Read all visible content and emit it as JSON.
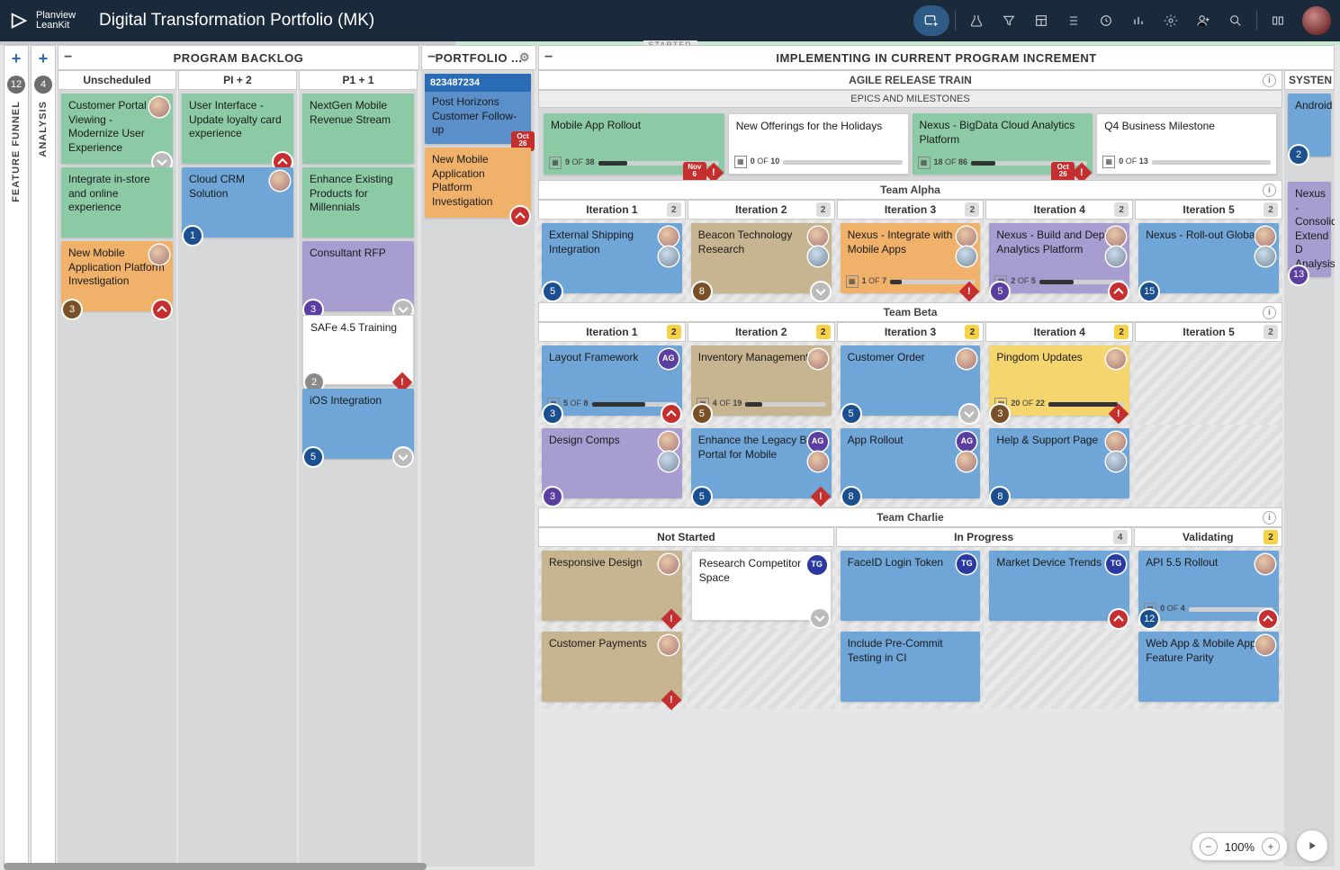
{
  "app": {
    "brand_top": "Planview",
    "brand_bottom": "LeanKit",
    "title": "Digital Transformation Portfolio (MK)"
  },
  "progress_label": "STARTED",
  "rails": [
    {
      "count": "12",
      "label": "FEATURE FUNNEL"
    },
    {
      "count": "4",
      "label": "ANALYSIS"
    }
  ],
  "backlog": {
    "header": "PROGRAM BACKLOG",
    "cols": [
      {
        "title": "Unscheduled",
        "cards": [
          {
            "t": "Customer Portal Viewing - Modernize User Experience",
            "c": "green",
            "av": true,
            "br": "chev"
          },
          {
            "t": "Integrate in-store and online experience",
            "c": "green"
          },
          {
            "t": "New Mobile Application Platform Investigation",
            "c": "orange",
            "av": true,
            "bl": "3",
            "blc": "brown",
            "br": "chev-red"
          }
        ]
      },
      {
        "title": "PI + 2",
        "cards": [
          {
            "t": "User Interface - Update loyalty card experience",
            "c": "green",
            "br": "chev-red"
          },
          {
            "t": "Cloud CRM Solution",
            "c": "blue",
            "av": true,
            "bl": "1",
            "blc": "blue"
          }
        ]
      },
      {
        "title": "P1 + 1",
        "cards": [
          {
            "t": "NextGen Mobile Revenue Stream",
            "c": "green"
          },
          {
            "t": "Enhance Existing Products for Millennials",
            "c": "green"
          },
          {
            "t": "Consultant RFP",
            "c": "purple",
            "bl": "3",
            "blc": "purple",
            "br": "chev"
          },
          {
            "t": "SAFe 4.5 Training",
            "c": "white",
            "bl": "2",
            "blc": "gray",
            "br": "alert"
          },
          {
            "t": "iOS Integration",
            "c": "blue",
            "bl": "5",
            "blc": "blue",
            "br": "chev"
          }
        ]
      }
    ]
  },
  "portfolio": {
    "header": "PORTFOLIO ...",
    "cards": [
      {
        "id": "823487234",
        "t": "Post Horizons Customer Follow-up",
        "c": "bluehdr",
        "date": {
          "m": "Oct",
          "d": "26"
        }
      },
      {
        "t": "New Mobile Application Platform Investigation",
        "c": "orange",
        "br": "chev-red"
      }
    ]
  },
  "impl": {
    "header": "IMPLEMENTING IN CURRENT PROGRAM INCREMENT",
    "art": {
      "title": "AGILE RELEASE TRAIN",
      "epics_label": "EPICS AND MILESTONES",
      "epics": [
        {
          "t": "Mobile App Rollout",
          "c": "green",
          "p": {
            "a": "9",
            "b": "38"
          },
          "date": {
            "m": "Nov",
            "d": "6"
          },
          "alert": true
        },
        {
          "t": "New Offerings for the Holidays",
          "c": "white",
          "p": {
            "a": "0",
            "b": "10"
          }
        },
        {
          "t": "Nexus - BigData Cloud Analytics Platform",
          "c": "green",
          "p": {
            "a": "18",
            "b": "86"
          },
          "date": {
            "m": "Oct",
            "d": "26"
          },
          "alert": true
        },
        {
          "t": "Q4 Business Milestone",
          "c": "white",
          "p": {
            "a": "0",
            "b": "13"
          }
        }
      ],
      "teams": [
        {
          "name": "Team Alpha",
          "iters": [
            {
              "title": "Iteration 1",
              "badge": "2",
              "bc": "gray"
            },
            {
              "title": "Iteration 2",
              "badge": "2",
              "bc": "gray"
            },
            {
              "title": "Iteration 3",
              "badge": "2",
              "bc": "gray"
            },
            {
              "title": "Iteration 4",
              "badge": "2",
              "bc": "gray"
            },
            {
              "title": "Iteration 5",
              "badge": "2",
              "bc": "gray"
            }
          ],
          "rows": [
            [
              {
                "t": "External Shipping Integration",
                "c": "blue",
                "av": 2,
                "bl": "5",
                "blc": "blue"
              },
              {
                "t": "Beacon Technology Research",
                "c": "tan",
                "av": 2,
                "bl": "8",
                "blc": "brown",
                "br": "chev"
              },
              {
                "t": "Nexus - Integrate with Mobile Apps",
                "c": "orange",
                "av": 2,
                "p": {
                  "a": "1",
                  "b": "7"
                },
                "br": "alert"
              },
              {
                "t": "Nexus - Build and Deploy Analytics Platform",
                "c": "purple",
                "av": 2,
                "p": {
                  "a": "2",
                  "b": "5"
                },
                "bl": "5",
                "blc": "purple",
                "br": "chev-red"
              },
              {
                "t": "Nexus - Roll-out Globally",
                "c": "blue",
                "av": 2,
                "bl": "15",
                "blc": "blue"
              }
            ]
          ]
        },
        {
          "name": "Team Beta",
          "iters": [
            {
              "title": "Iteration 1",
              "badge": "2",
              "bc": "yellow"
            },
            {
              "title": "Iteration 2",
              "badge": "2",
              "bc": "yellow"
            },
            {
              "title": "Iteration 3",
              "badge": "2",
              "bc": "yellow"
            },
            {
              "title": "Iteration 4",
              "badge": "2",
              "bc": "yellow"
            },
            {
              "title": "Iteration 5",
              "badge": "2",
              "bc": "gray"
            }
          ],
          "rows": [
            [
              {
                "t": "Layout Framework",
                "c": "blue",
                "ag": "AG",
                "p": {
                  "a": "5",
                  "b": "8"
                },
                "bl": "3",
                "blc": "blue",
                "br": "chev-red"
              },
              {
                "t": "Inventory Management",
                "c": "tan",
                "av": 1,
                "p": {
                  "a": "4",
                  "b": "19"
                },
                "bl": "5",
                "blc": "brown"
              },
              {
                "t": "Customer Order",
                "c": "blue",
                "av": 1,
                "bl": "5",
                "blc": "blue",
                "br": "chev"
              },
              {
                "t": "Pingdom Updates",
                "c": "yellow",
                "av": 1,
                "p": {
                  "a": "20",
                  "b": "22"
                },
                "bl": "3",
                "blc": "brown",
                "br": "alert"
              },
              null
            ],
            [
              {
                "t": "Design Comps",
                "c": "purple",
                "av": 2,
                "bl": "3",
                "blc": "purple"
              },
              {
                "t": "Enhance the Legacy BI Portal for Mobile",
                "c": "blue",
                "ag": "AG",
                "av2": true,
                "bl": "5",
                "blc": "blue",
                "br": "alert"
              },
              {
                "t": "App Rollout",
                "c": "blue",
                "ag": "AG",
                "av2": true,
                "bl": "8",
                "blc": "blue"
              },
              {
                "t": "Help & Support Page",
                "c": "blue",
                "av": 2,
                "bl": "8",
                "blc": "blue"
              },
              null
            ]
          ]
        },
        {
          "name": "Team Charlie",
          "cols": [
            {
              "title": "Not Started",
              "span": 2,
              "cards": [
                [
                  {
                    "t": "Responsive Design",
                    "c": "tan",
                    "av": 1,
                    "br": "alert"
                  },
                  {
                    "t": "Research Competitor Space",
                    "c": "white",
                    "ag": "TG",
                    "br": "chev"
                  }
                ],
                [
                  {
                    "t": "Customer Payments",
                    "c": "tan",
                    "av": 1,
                    "br": "alert"
                  },
                  null
                ]
              ]
            },
            {
              "title": "In Progress",
              "badge": "4",
              "bc": "gray",
              "span": 2,
              "cards": [
                [
                  {
                    "t": "FaceID Login Token",
                    "c": "blue",
                    "ag": "TG",
                    "tgc": true
                  },
                  {
                    "t": "Market Device Trends",
                    "c": "blue",
                    "av": 1,
                    "ag": "TG",
                    "br": "chev-red"
                  }
                ],
                [
                  {
                    "t": "Include Pre-Commit Testing in CI",
                    "c": "blue"
                  },
                  null
                ]
              ]
            },
            {
              "title": "Validating",
              "badge": "2",
              "bc": "yellow",
              "span": 1,
              "cards": [
                [
                  {
                    "t": "API 5.5 Rollout",
                    "c": "blue",
                    "av": 1,
                    "p": {
                      "a": "0",
                      "b": "4"
                    },
                    "bl": "12",
                    "blc": "blue",
                    "br": "chev-red"
                  }
                ],
                [
                  {
                    "t": "Web App & Mobile App Feature Parity",
                    "c": "blue",
                    "av": 1
                  }
                ]
              ]
            }
          ]
        }
      ]
    },
    "system": {
      "title": "SYSTEN",
      "cards": [
        {
          "t": "Android",
          "c": "blue",
          "bl": "2",
          "blc": "blue"
        },
        {
          "t": "Nexus - Consolid Extend D Analysis",
          "c": "purple",
          "bl": "13",
          "blc": "purple"
        }
      ]
    }
  },
  "zoom": "100%"
}
